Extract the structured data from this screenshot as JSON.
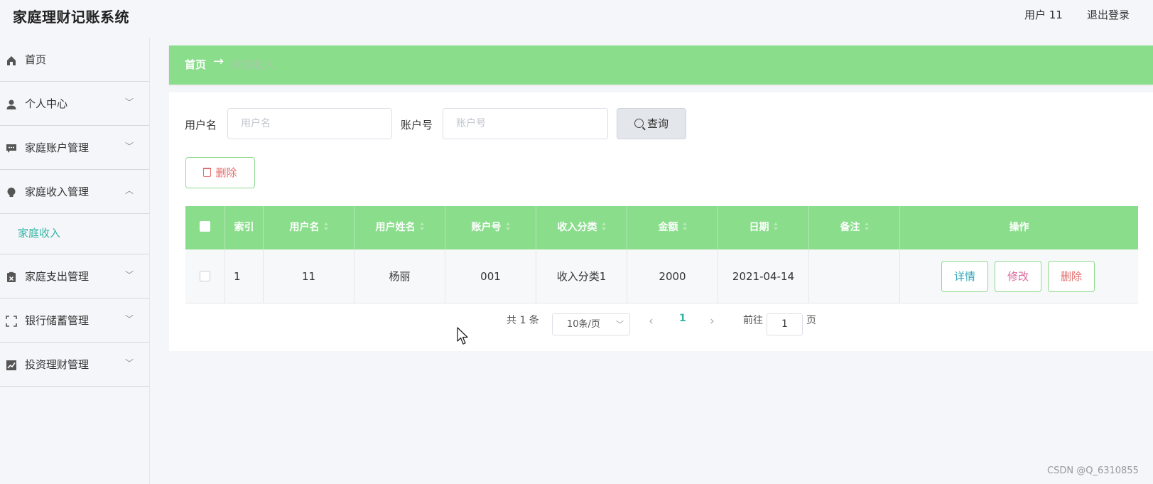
{
  "header": {
    "app_title": "家庭理财记账系统",
    "user_label": "用户 11",
    "logout_label": "退出登录"
  },
  "sidebar": {
    "items": [
      {
        "label": "首页",
        "icon": "home-icon"
      },
      {
        "label": "个人中心",
        "icon": "user-icon"
      },
      {
        "label": "家庭账户管理",
        "icon": "message-icon"
      },
      {
        "label": "家庭收入管理",
        "icon": "bulb-icon"
      },
      {
        "label": "家庭支出管理",
        "icon": "clipboard-icon"
      },
      {
        "label": "银行储蓄管理",
        "icon": "fullscreen-icon"
      },
      {
        "label": "投资理财管理",
        "icon": "chart-icon"
      }
    ],
    "submenu": {
      "label": "家庭收入"
    }
  },
  "breadcrumb": {
    "home": "首页",
    "arrow": "→",
    "current": "家庭收入"
  },
  "search": {
    "username_label": "用户名",
    "username_placeholder": "用户名",
    "account_label": "账户号",
    "account_placeholder": "账户号",
    "query_label": "查询"
  },
  "toolbar": {
    "delete_label": "删除"
  },
  "table": {
    "headers": [
      "索引",
      "用户名",
      "用户姓名",
      "账户号",
      "收入分类",
      "金额",
      "日期",
      "备注",
      "操作"
    ],
    "rows": [
      {
        "index": "1",
        "username": "11",
        "name": "杨丽",
        "account": "001",
        "category": "收入分类1",
        "amount": "2000",
        "date": "2021-04-14",
        "note": ""
      }
    ],
    "row_actions": {
      "detail": "详情",
      "edit": "修改",
      "delete": "删除"
    }
  },
  "pagination": {
    "total": "共 1 条",
    "page_size": "10条/页",
    "prev": "‹",
    "current_page": "1",
    "next": "›",
    "goto_label": "前往",
    "goto_value": "1",
    "page_suffix": "页"
  },
  "colors": {
    "accent_green": "#89dd8b",
    "submenu_teal": "#33b5a5",
    "danger": "#e46b6b",
    "edit_pink": "#d9689a",
    "detail_teal": "#3aa8b8"
  },
  "watermark": "CSDN @Q_6310855"
}
